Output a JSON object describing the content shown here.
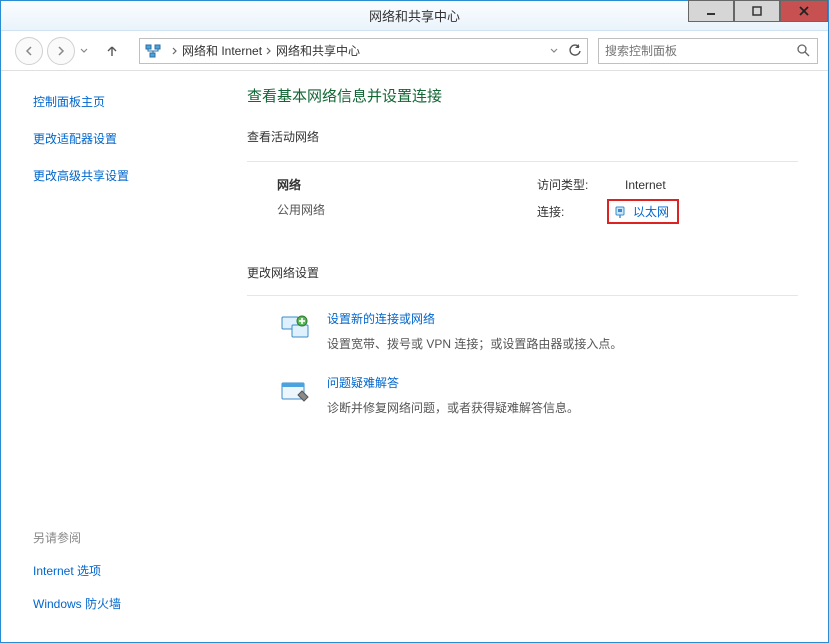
{
  "window": {
    "title": "网络和共享中心"
  },
  "breadcrumb": {
    "item1": "网络和 Internet",
    "item2": "网络和共享中心"
  },
  "search": {
    "placeholder": "搜索控制面板"
  },
  "sidebar": {
    "home": "控制面板主页",
    "adapter": "更改适配器设置",
    "advanced": "更改高级共享设置",
    "see_also_hdr": "另请参阅",
    "internet_options": "Internet 选项",
    "firewall": "Windows 防火墙"
  },
  "main": {
    "heading": "查看基本网络信息并设置连接",
    "active_hdr": "查看活动网络",
    "net_name": "网络",
    "net_type": "公用网络",
    "access_label": "访问类型:",
    "access_value": "Internet",
    "conn_label": "连接:",
    "conn_value": "以太网",
    "change_hdr": "更改网络设置",
    "task1_title": "设置新的连接或网络",
    "task1_desc": "设置宽带、拨号或 VPN 连接；或设置路由器或接入点。",
    "task2_title": "问题疑难解答",
    "task2_desc": "诊断并修复网络问题，或者获得疑难解答信息。"
  }
}
